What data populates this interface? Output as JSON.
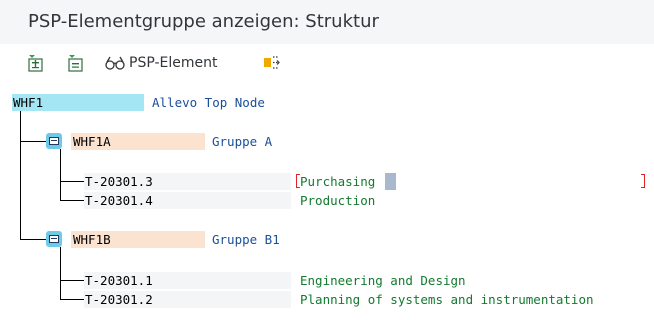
{
  "window": {
    "title": "PSP-Elementgruppe anzeigen: Struktur"
  },
  "toolbar": {
    "buttons": [
      {
        "icon": "expand-all-icon"
      },
      {
        "icon": "collapse-all-icon"
      },
      {
        "icon": "glasses-icon",
        "label": "PSP-Element"
      },
      {
        "icon": "hierarchy-icon"
      }
    ]
  },
  "tree": {
    "root": {
      "code": "WHF1",
      "description": "Allevo Top Node"
    },
    "groups": [
      {
        "code": "WHF1A",
        "description": "Gruppe A",
        "items": [
          {
            "code": "T-20301.3",
            "description": "Purchasing"
          },
          {
            "code": "T-20301.4",
            "description": "Production"
          }
        ]
      },
      {
        "code": "WHF1B",
        "description": "Gruppe B1",
        "items": [
          {
            "code": "T-20301.1",
            "description": "Engineering and Design"
          },
          {
            "code": "T-20301.2",
            "description": "Planning of systems and instrumentation"
          }
        ]
      }
    ]
  },
  "colors": {
    "root_highlight": "#a5e6f5",
    "group_highlight": "#fbe3cf",
    "description_blue": "#1b4e9b",
    "description_green": "#137a2f",
    "focus_bracket": "#e0242b"
  }
}
